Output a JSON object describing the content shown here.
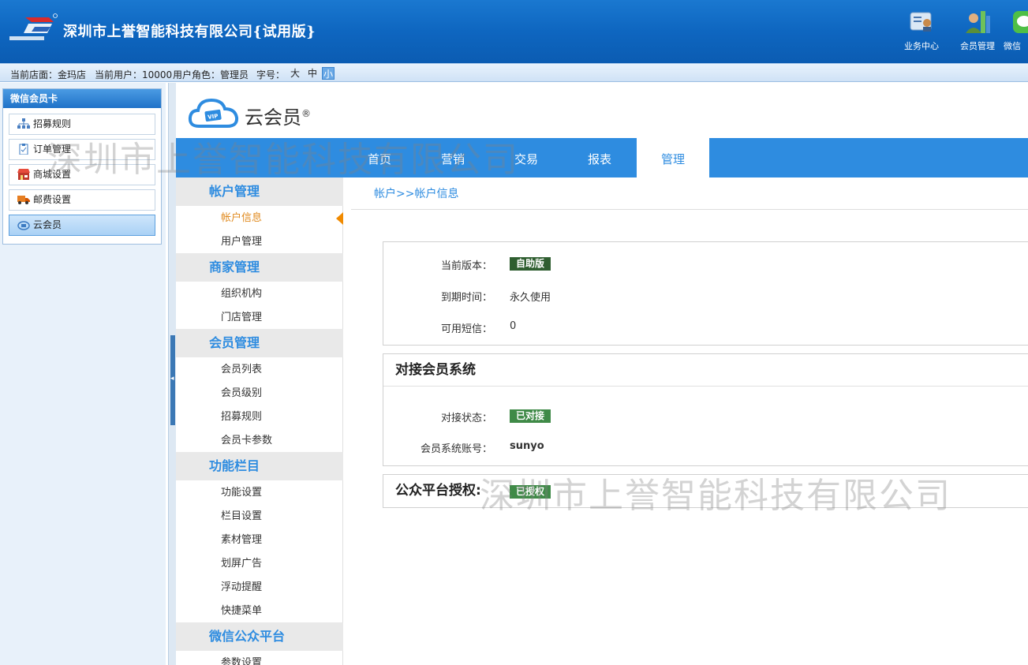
{
  "header": {
    "company": "深圳市上誉智能科技有限公司{试用版}",
    "nav": [
      {
        "label": "业务中心",
        "icon": "business-center-icon"
      },
      {
        "label": "会员管理",
        "icon": "member-management-icon"
      },
      {
        "label": "微信",
        "icon": "wechat-icon"
      }
    ]
  },
  "infobar": {
    "store": "当前店面：金玛店",
    "user": "当前用户：10000",
    "role": "用户角色：管理员",
    "font_label": "字号：",
    "font_sizes": [
      "大",
      "中",
      "小"
    ],
    "font_selected": "小"
  },
  "sidebar": {
    "title": "微信会员卡",
    "items": [
      {
        "label": "招募规则",
        "icon": "org-chart-icon"
      },
      {
        "label": "订单管理",
        "icon": "clipboard-icon"
      },
      {
        "label": "商城设置",
        "icon": "store-icon"
      },
      {
        "label": "邮费设置",
        "icon": "truck-icon"
      },
      {
        "label": "云会员",
        "icon": "cloud-vip-icon",
        "active": true
      }
    ]
  },
  "brand": {
    "name": "云会员",
    "mark": "®",
    "logo_text": "VIP"
  },
  "mainnav": {
    "tabs": [
      "首页",
      "营销",
      "交易",
      "报表",
      "管理"
    ],
    "active": "管理"
  },
  "submenu": {
    "groups": [
      {
        "title": "帐户管理",
        "items": [
          "帐户信息",
          "用户管理"
        ]
      },
      {
        "title": "商家管理",
        "items": [
          "组织机构",
          "门店管理"
        ]
      },
      {
        "title": "会员管理",
        "items": [
          "会员列表",
          "会员级别",
          "招募规则",
          "会员卡参数"
        ]
      },
      {
        "title": "功能栏目",
        "items": [
          "功能设置",
          "栏目设置",
          "素材管理",
          "划屏广告",
          "浮动提醒",
          "快捷菜单"
        ]
      },
      {
        "title": "微信公众平台",
        "items": [
          "参数设置"
        ]
      }
    ],
    "active_item": "帐户信息"
  },
  "breadcrumb": "帐户>>帐户信息",
  "account": {
    "version_label": "当前版本：",
    "version_value": "自助版",
    "expiry_label": "到期时间：",
    "expiry_value": "永久使用",
    "sms_label": "可用短信：",
    "sms_value": "0"
  },
  "member_system": {
    "title": "对接会员系统",
    "status_label": "对接状态：",
    "status_value": "已对接",
    "account_label": "会员系统账号：",
    "account_value": "sunyo"
  },
  "public_platform": {
    "title": "公众平台授权:",
    "status_value": "已授权"
  },
  "watermark": "深圳市上誉智能科技有限公司",
  "colors": {
    "banner": "#0e66c0",
    "accent": "#2e8ce0",
    "active_orange": "#e08a1e",
    "badge_dark": "#2f5e30",
    "badge_green": "#3f8a47"
  }
}
